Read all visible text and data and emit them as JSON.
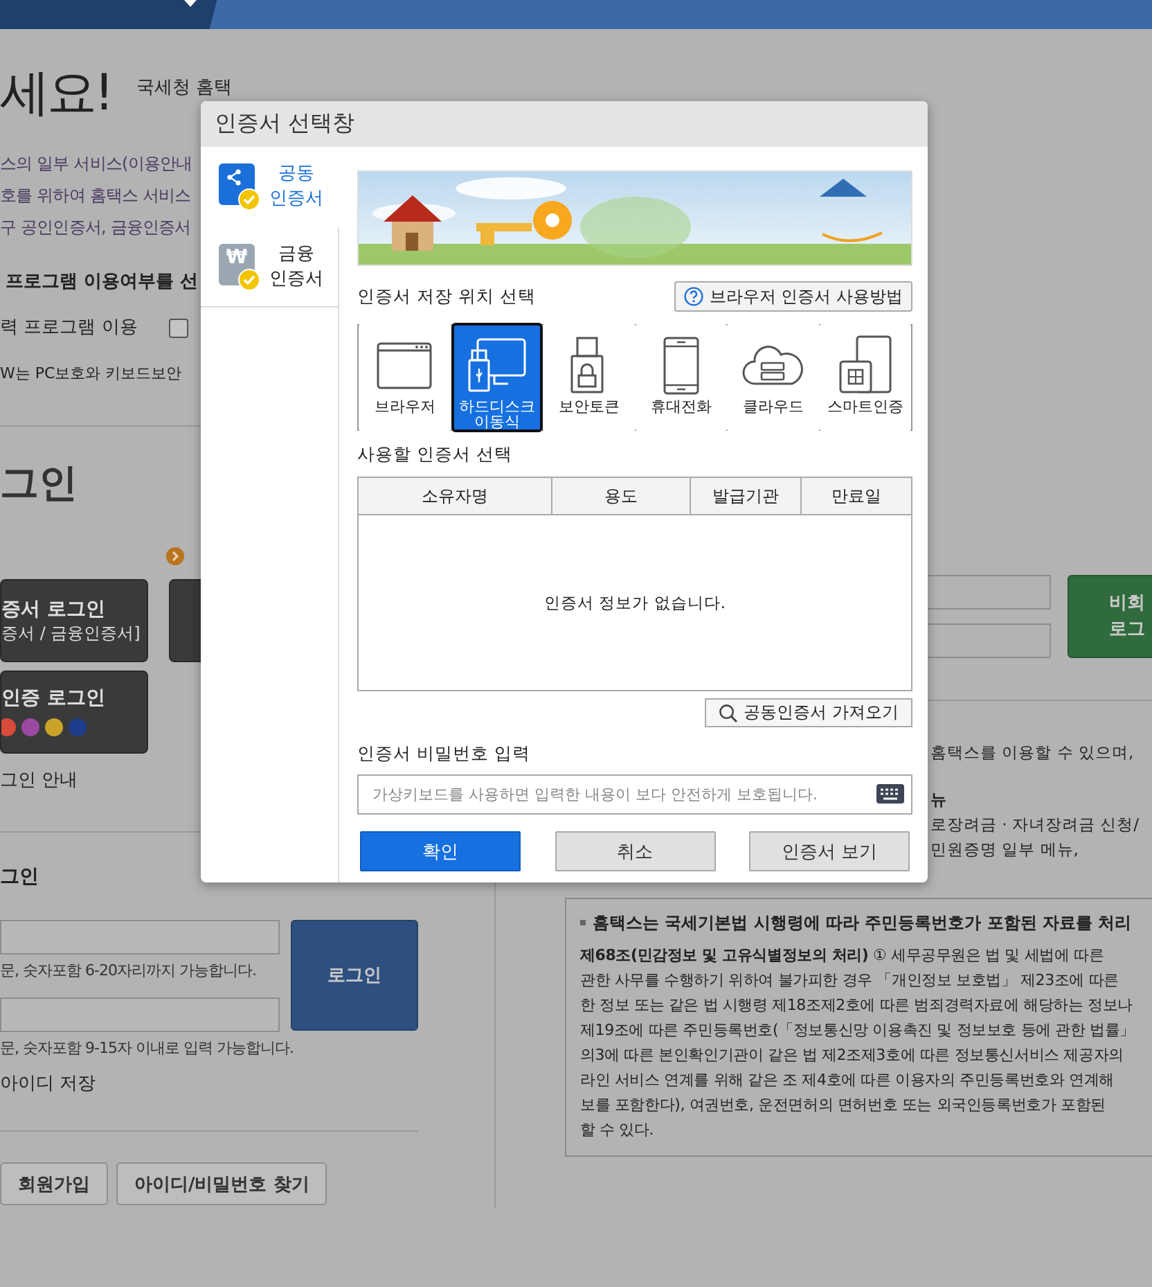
{
  "background": {
    "greeting": "세요!",
    "welcome": "국세청 홈택",
    "notice_lines": [
      "스의 일부 서비스(이용안내",
      "호를 위하여 홈택스 서비스",
      "구 공인인증서, 금융인증서"
    ],
    "program_heading": "프로그램 이용여부를 선",
    "program_option": "력 프로그램 이용",
    "keyboard_option": {
      "checked": false
    },
    "program_note": "W는 PC보호와 키보드보안",
    "login_heading": "그인",
    "login_buttons": [
      {
        "title": "증서 로그인",
        "subtitle": "증서 / 금융인증서]"
      },
      {
        "title": "인증 로그인"
      }
    ],
    "login_guide": "그인 안내",
    "id_login": {
      "heading": "그인",
      "id_hint": "문, 숫자포함 6-20자리까지 가능합니다.",
      "password_hint": "문, 숫자포함 9-15자 이내로 입력 가능합니다.",
      "login_button": "로그인",
      "save_id": "아이디 저장"
    },
    "bottom_buttons": [
      "회원가입",
      "아이디/비밀번호 찾기"
    ],
    "guest_login": [
      "비회",
      "로그"
    ],
    "info_lines": [
      {
        "text": "홈택스를 이용할 수 있으며,",
        "kind": "plain"
      },
      {
        "text": "뉴",
        "kind": "heading"
      },
      {
        "text": "로장려금 · 자녀장려금 신청/",
        "kind": "plain"
      },
      {
        "text": "민원증명 일부 메뉴,",
        "kind": "plain"
      }
    ],
    "privacy": {
      "heading": "홈택스는 국세기본법 시행령에 따라 주민등록번호가 포함된 자료를 처리",
      "lines": [
        "**제68조(민감정보 및 고유식별정보의 처리)** ① 세무공무원은 법 및 세법에 따른",
        "관한 사무를 수행하기 위하여 불가피한 경우 「개인정보 보호법」 제23조에 따른",
        "한 정보 또는 같은 법 시행령 제18조제2호에 따른 범죄경력자료에 해당하는 정보나",
        "제19조에 따른 주민등록번호(「정보통신망 이용촉진 및 정보보호 등에 관한 법률」",
        "의3에 따른 본인확인기관이 같은 법 제2조제3호에 따른 정보통신서비스 제공자의",
        "라인 서비스 연계를 위해 같은 조 제4호에 따른 이용자의 주민등록번호와 연계해",
        "보를 포함한다), 여권번호, 운전면허의 면허번호 또는 외국인등록번호가 포함된",
        "할 수 있다."
      ]
    }
  },
  "dialog": {
    "title": "인증서 선택창",
    "cert_types": [
      {
        "label_lines": [
          "공동",
          "인증서"
        ],
        "kind": "share",
        "selected": true
      },
      {
        "label_lines": [
          "금융",
          "인증서"
        ],
        "kind": "won",
        "icon_glyph": "₩",
        "selected": false
      }
    ],
    "location_heading": "인증서 저장 위치 선택",
    "help_button": "브라우저 인증서 사용방법",
    "locations": [
      {
        "label": "브라우저",
        "kind": "browser",
        "selected": false
      },
      {
        "label": "하드디스크 이동식",
        "kind": "drive",
        "selected": true
      },
      {
        "label": "보안토큰",
        "kind": "token",
        "selected": false
      },
      {
        "label": "휴대전화",
        "kind": "phone",
        "selected": false
      },
      {
        "label": "클라우드",
        "kind": "cloud",
        "selected": false
      },
      {
        "label": "스마트인증",
        "kind": "smart",
        "selected": false
      }
    ],
    "table_heading": "사용할 인증서 선택",
    "columns": [
      "소유자명",
      "용도",
      "발급기관",
      "만료일"
    ],
    "empty_message": "인증서 정보가 없습니다.",
    "import_button": "공동인증서 가져오기",
    "password_heading": "인증서 비밀번호 입력",
    "password_placeholder": "가상키보드를 사용하면 입력한 내용이 보다 안전하게 보호됩니다.",
    "buttons": [
      {
        "label": "확인",
        "kind": "primary"
      },
      {
        "label": "취소",
        "kind": "secondary"
      },
      {
        "label": "인증서 보기",
        "kind": "secondary"
      }
    ]
  }
}
